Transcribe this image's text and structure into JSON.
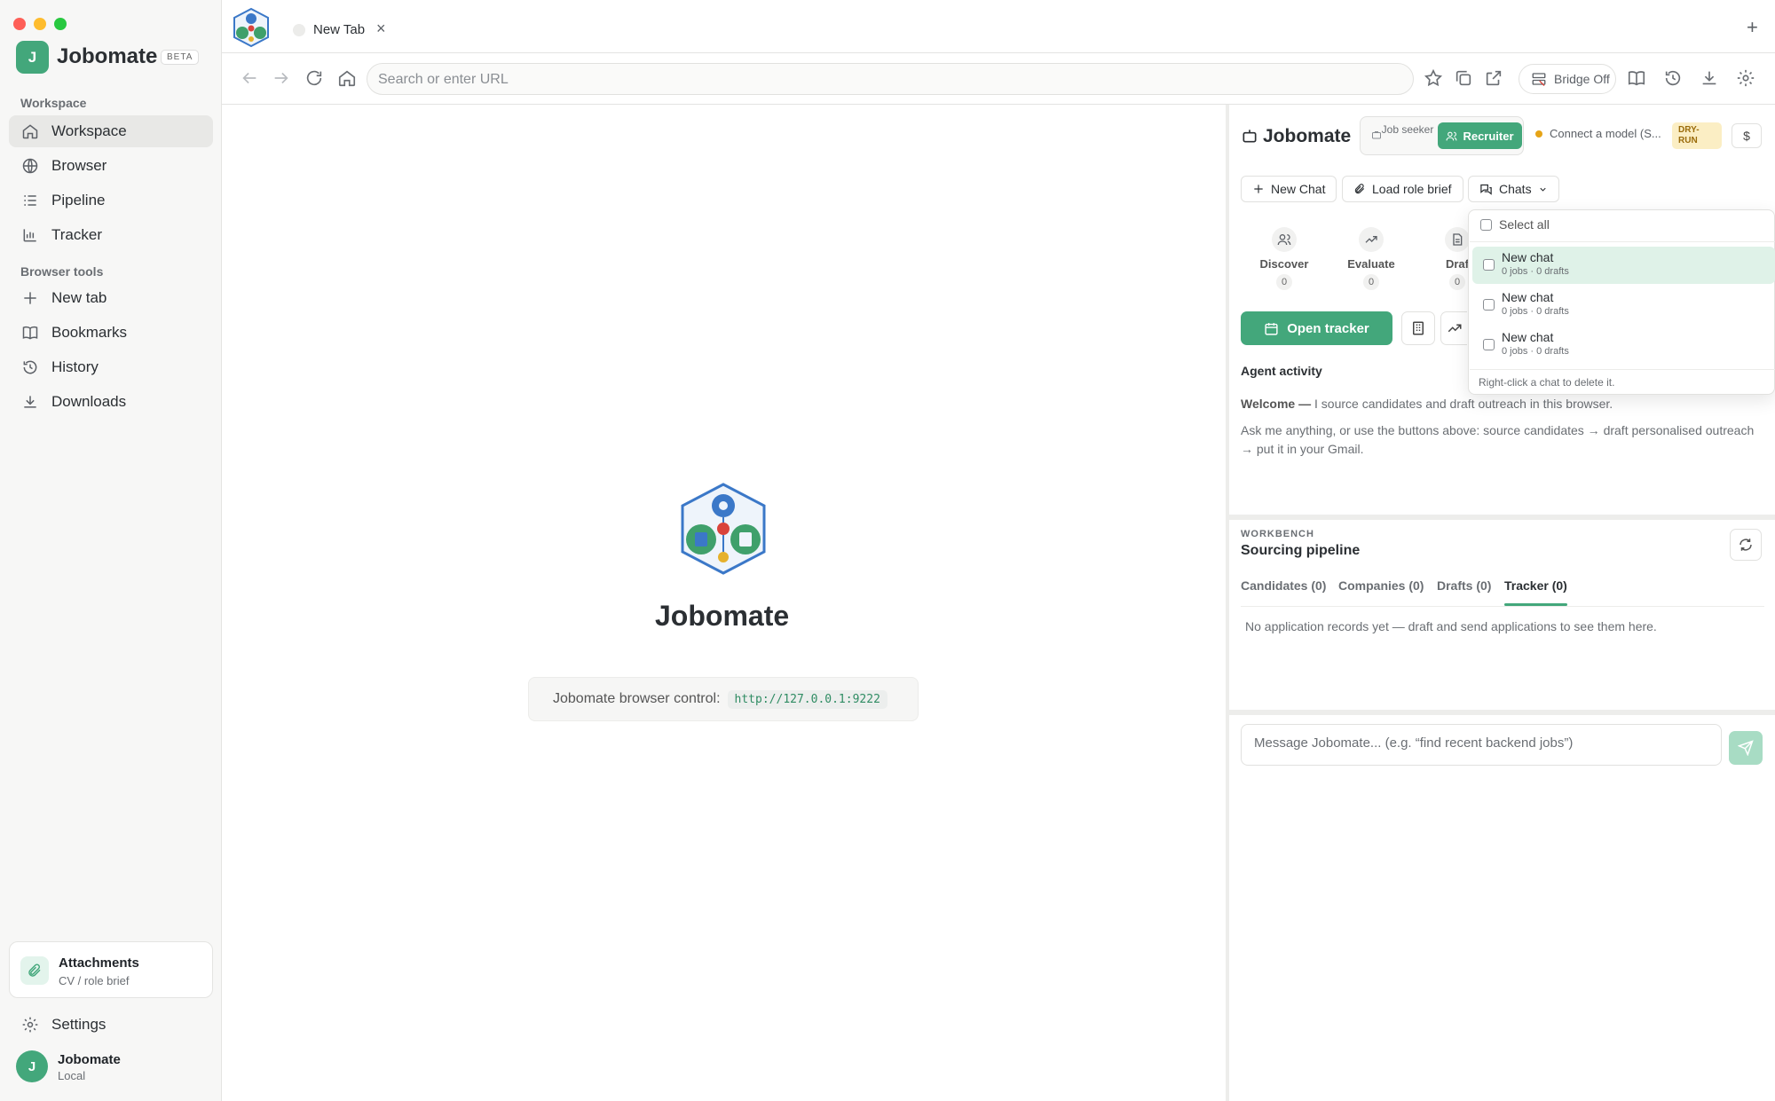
{
  "sidebar": {
    "brand_letter": "J",
    "brand_name": "Jobomate",
    "beta": "BETA",
    "workspace_label": "Workspace",
    "nav": [
      {
        "label": "Workspace",
        "icon": "home-icon"
      },
      {
        "label": "Browser",
        "icon": "globe-icon"
      },
      {
        "label": "Pipeline",
        "icon": "list-icon"
      },
      {
        "label": "Tracker",
        "icon": "bar-chart-icon"
      }
    ],
    "tools_label": "Browser tools",
    "tools": [
      {
        "label": "New tab",
        "icon": "plus-icon"
      },
      {
        "label": "Bookmarks",
        "icon": "book-icon"
      },
      {
        "label": "History",
        "icon": "history-icon"
      },
      {
        "label": "Downloads",
        "icon": "download-icon"
      }
    ],
    "attachments_title": "Attachments",
    "attachments_sub": "CV / role brief",
    "settings": "Settings",
    "user_letter": "J",
    "user_name": "Jobomate",
    "user_sub": "Local"
  },
  "tabbar": {
    "tab_title": "New Tab",
    "close": "×",
    "new_tab": "+"
  },
  "toolbar": {
    "url_placeholder": "Search or enter URL",
    "bridge": "Bridge Off"
  },
  "content": {
    "title": "Jobomate",
    "bridge_label": "Jobomate browser control:",
    "bridge_url": "http://127.0.0.1:9222"
  },
  "panel": {
    "title": "Jobomate",
    "mode_seeker": "Job seeker",
    "mode_recruiter": "Recruiter",
    "model": "Connect a model (S...",
    "dry_run": "DRY-RUN",
    "dollar": "$",
    "new_chat": "New Chat",
    "load_brief": "Load role brief",
    "chats": "Chats",
    "stages": [
      {
        "label": "Discover",
        "count": "0"
      },
      {
        "label": "Evaluate",
        "count": "0"
      },
      {
        "label": "Draf",
        "count": "0"
      }
    ],
    "open_tracker": "Open tracker",
    "activity_title": "Agent activity",
    "welcome_bold": "Welcome —",
    "welcome_text": " I source candidates and draft outreach in this browser.",
    "ask_text": "Ask me anything, or use the buttons above: source candidates → draft personalised outreach → put it in your Gmail.",
    "workbench_label": "WORKBENCH",
    "workbench_title": "Sourcing pipeline",
    "tabs": [
      "Candidates (0)",
      "Companies (0)",
      "Drafts (0)",
      "Tracker (0)"
    ],
    "empty": "No application records yet — draft and send applications to see them here.",
    "message_placeholder": "Message Jobomate...  (e.g. “find recent backend jobs”)"
  },
  "dropdown": {
    "select_all": "Select all",
    "items": [
      {
        "name": "New chat",
        "sub": "0 jobs · 0 drafts"
      },
      {
        "name": "New chat",
        "sub": "0 jobs · 0 drafts"
      },
      {
        "name": "New chat",
        "sub": "0 jobs · 0 drafts"
      }
    ],
    "footer": "Right-click a chat to delete it."
  },
  "colors": {
    "accent": "#43a77b",
    "accent_light": "#dff2e8",
    "dry_run_bg": "#fbeec4"
  }
}
